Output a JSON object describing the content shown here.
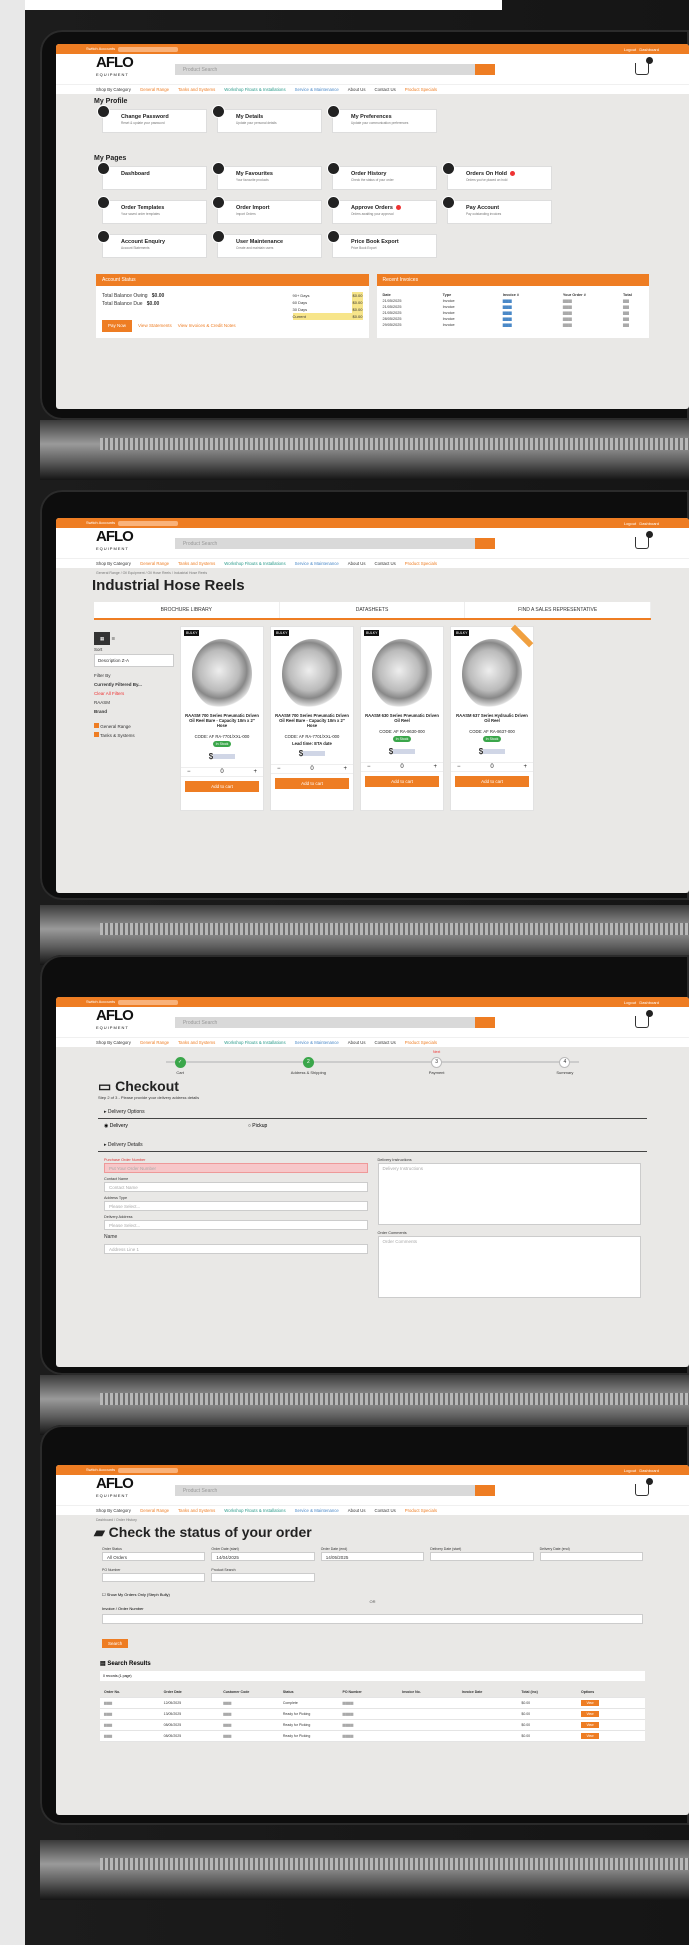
{
  "common": {
    "switch_account": "Switch Accounts",
    "logout": "Logout",
    "dashboard": "Dashboard",
    "logo": "AFLO",
    "logo_sub": "EQUIPMENT",
    "search_placeholder": "Product Search",
    "nav": [
      "Shop By Category",
      "General Range",
      "Tanks and Systems",
      "Workshop Fitouts & Installations",
      "Service & Maintenance",
      "About Us",
      "Contact Us",
      "Product Specials"
    ]
  },
  "screen1": {
    "my_profile": "My Profile",
    "profile_tiles": [
      {
        "label": "Change Password",
        "sub": "Reset & update your password"
      },
      {
        "label": "My Details",
        "sub": "Update your personal details"
      },
      {
        "label": "My Preferences",
        "sub": "Update your communication preferences"
      }
    ],
    "my_pages": "My Pages",
    "page_tiles": [
      {
        "label": "Dashboard",
        "sub": ""
      },
      {
        "label": "My Favourites",
        "sub": "Your favourite products"
      },
      {
        "label": "Order History",
        "sub": "Check the status of your order"
      },
      {
        "label": "Orders On Hold",
        "sub": "Orders you've placed on hold"
      },
      {
        "label": "Order Templates",
        "sub": "Your saved order templates"
      },
      {
        "label": "Order Import",
        "sub": "Import Orders"
      },
      {
        "label": "Approve Orders",
        "sub": "Orders awaiting your approval"
      },
      {
        "label": "Pay Account",
        "sub": "Pay outstanding invoices"
      },
      {
        "label": "Account Enquiry",
        "sub": "Account Statements"
      },
      {
        "label": "User Maintenance",
        "sub": "Create and maintain users"
      },
      {
        "label": "Price Book Export",
        "sub": "Price Book Export"
      }
    ],
    "account_status": {
      "title": "Account Status",
      "balance_owing_label": "Total Balance Owing",
      "balance_owing": "$0.00",
      "balance_due_label": "Total Balance Due",
      "balance_due": "$0.00",
      "aging": [
        [
          "90+ Days",
          "$0.00"
        ],
        [
          "60 Days",
          "$0.00"
        ],
        [
          "30 Days",
          "$0.00"
        ],
        [
          "Current",
          "$0.00"
        ]
      ],
      "pay_now": "Pay Now",
      "view_statements": "View Statements",
      "view_invoices": "View Invoices & Credit Notes"
    },
    "recent_invoices": {
      "title": "Recent Invoices",
      "headers": [
        "Date",
        "Type",
        "Invoice #",
        "Your Order #",
        "Total"
      ],
      "rows": [
        [
          "21/05/2025",
          "Invoice"
        ],
        [
          "21/05/2025",
          "Invoice"
        ],
        [
          "21/05/2025",
          "Invoice"
        ],
        [
          "28/05/2025",
          "Invoice"
        ],
        [
          "29/05/2025",
          "Invoice"
        ]
      ]
    }
  },
  "screen2": {
    "page_title": "Industrial Hose Reels",
    "breadcrumb": "General Range / Oil Equipment / Oil Hose Reels / Industrial Hose Reels",
    "tabs": [
      "BROCHURE LIBRARY",
      "DATASHEETS",
      "FIND A SALES REPRESENTATIVE"
    ],
    "sort_label": "Sort",
    "sort_value": "Description Z-A",
    "filter_label": "Filter By",
    "currently_filtered": "Currently Filtered By...",
    "clear_filters": "Clear All Filters",
    "filter_brand_value": "RAASM",
    "brand_label": "Brand",
    "categories": [
      "General Range",
      "Tanks & Systems"
    ],
    "products": [
      {
        "badge": "BULKY",
        "name": "RAASM 700 Series Pneumatic Driven Oil Reel Bare - Capacity 10m x 2\" Hose",
        "code": "CODE: AF RA-7701/XXL-000",
        "stock": "In Stock",
        "qty": "0",
        "add": "Add to cart"
      },
      {
        "badge": "BULKY",
        "name": "RAASM 700 Series Pneumatic Driven Oil Reel Bare - Capacity 10m x 2\" Hose",
        "code": "CODE: AF RA-7701/XXL-000",
        "stock": "Lead time: ETA date",
        "qty": "0",
        "add": "Add to cart"
      },
      {
        "badge": "BULKY",
        "name": "RAASM 630 Series Pneumatic Driven Oil Reel",
        "code": "CODE: AF RA-8630-000",
        "stock": "In Stock",
        "qty": "0",
        "add": "Add to cart"
      },
      {
        "badge": "BULKY",
        "name": "RAASM 637 Series Hydraulic Driven Oil Reel",
        "code": "CODE: AF RA-8637-000",
        "stock": "In Stock",
        "qty": "0",
        "add": "Add to cart"
      }
    ]
  },
  "screen3": {
    "steps": [
      {
        "n": "✓",
        "label": "Cart"
      },
      {
        "n": "2",
        "label": "Address & Shipping"
      },
      {
        "n": "3",
        "label": "Payment",
        "tag": "Next"
      },
      {
        "n": "4",
        "label": "Summary"
      }
    ],
    "title": "Checkout",
    "subtitle": "Step 2 of 3 - Please provide your delivery address details",
    "delivery_options": "Delivery Options",
    "delivery": "Delivery",
    "pickup": "Pickup",
    "delivery_details": "Delivery Details",
    "po_label": "Purchase Order Number",
    "po_placeholder": "Put Your Order Number",
    "contact_label": "Contact Name",
    "contact_placeholder": "Contact Name",
    "addr_type_label": "Address Type",
    "addr_type_value": "Please Select...",
    "deliv_addr_label": "Delivery Address",
    "deliv_addr_value": "Please Select...",
    "name_label": "Name",
    "addr1_placeholder": "Address Line 1",
    "instructions_label": "Delivery Instructions",
    "instructions_placeholder": "Delivery Instructions",
    "comments_label": "Order Comments",
    "comments_placeholder": "Order Comments"
  },
  "screen4": {
    "breadcrumb": "Dashboard / Order History",
    "title": "Check the status of your order",
    "filters": [
      {
        "label": "Order Status",
        "value": "All Orders"
      },
      {
        "label": "Order Date (start)",
        "value": "14/04/2025"
      },
      {
        "label": "Order Date (end)",
        "value": "14/05/2025"
      },
      {
        "label": "Delivery Date (start)",
        "value": ""
      },
      {
        "label": "Delivery Date (end)",
        "value": ""
      }
    ],
    "po_number": "PO Number",
    "product_search": "Product Search",
    "show_my_orders": "Show My Orders Only (Steph Bully)",
    "or": "OR",
    "invoice_number": "Invoice / Order Number",
    "search_btn": "Search",
    "results_title": "Search Results",
    "results_count": "0 records (1 page)",
    "headers": [
      "Order No.",
      "Order Date",
      "Customer Code",
      "Status",
      "PO Number",
      "Invoice No.",
      "Invoice Date",
      "Total (inc)",
      "Options"
    ],
    "rows": [
      {
        "date": "12/05/2025",
        "status": "Complete",
        "total": "$0.00"
      },
      {
        "date": "13/05/2025",
        "status": "Ready for Picking",
        "total": "$0.00"
      },
      {
        "date": "08/05/2025",
        "status": "Ready for Picking",
        "total": "$0.00"
      },
      {
        "date": "08/05/2025",
        "status": "Ready for Picking",
        "total": "$0.00"
      }
    ],
    "view": "View"
  }
}
